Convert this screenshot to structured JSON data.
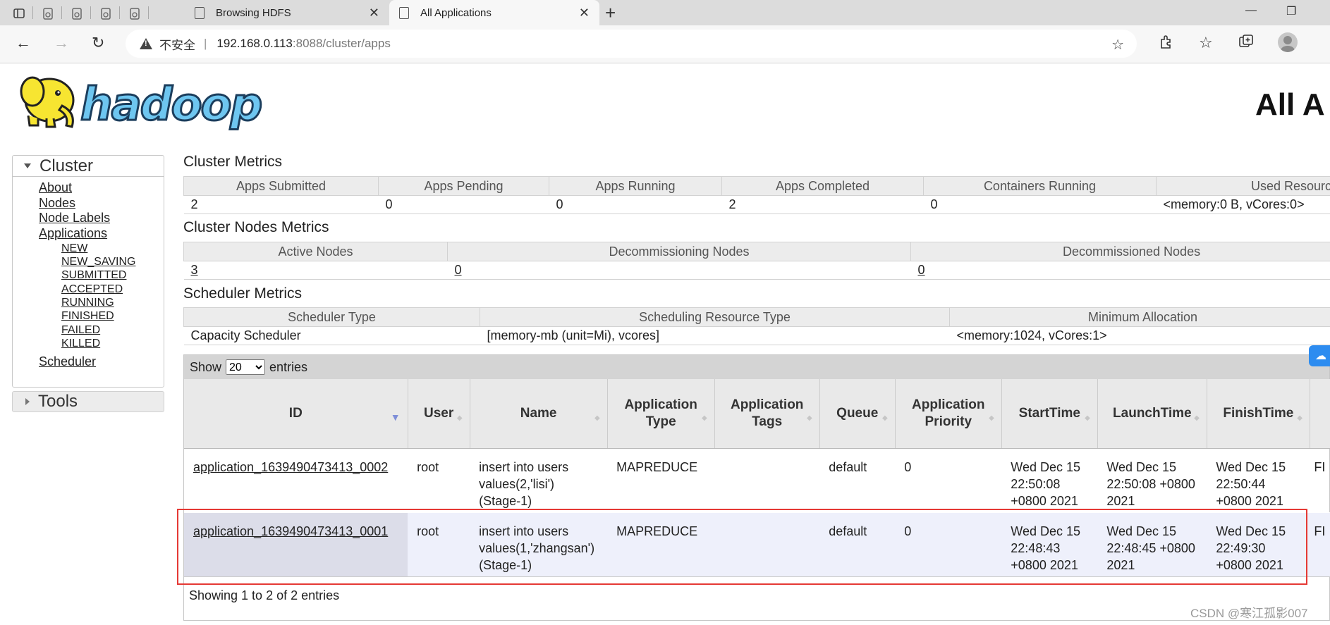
{
  "browser": {
    "tabs": [
      {
        "title": "Browsing HDFS",
        "active": false
      },
      {
        "title": "All Applications",
        "active": true
      }
    ],
    "security_label": "不安全",
    "url_host": "192.168.0.113",
    "url_rest": ":8088/cluster/apps"
  },
  "page": {
    "logo_text": "hadoop",
    "title": "All A"
  },
  "sidebar": {
    "cluster_title": "Cluster",
    "links": [
      "About",
      "Nodes",
      "Node Labels",
      "Applications"
    ],
    "app_states": [
      "NEW",
      "NEW_SAVING",
      "SUBMITTED",
      "ACCEPTED",
      "RUNNING",
      "FINISHED",
      "FAILED",
      "KILLED"
    ],
    "scheduler_link": "Scheduler",
    "tools_title": "Tools"
  },
  "cluster_metrics": {
    "title": "Cluster Metrics",
    "headers": [
      "Apps Submitted",
      "Apps Pending",
      "Apps Running",
      "Apps Completed",
      "Containers Running",
      "Used Resources"
    ],
    "values": [
      "2",
      "0",
      "0",
      "2",
      "0",
      "<memory:0 B, vCores:0>"
    ]
  },
  "node_metrics": {
    "title": "Cluster Nodes Metrics",
    "headers": [
      "Active Nodes",
      "Decommissioning Nodes",
      "Decommissioned Nodes"
    ],
    "values": [
      "3",
      "0",
      "0"
    ]
  },
  "scheduler_metrics": {
    "title": "Scheduler Metrics",
    "headers": [
      "Scheduler Type",
      "Scheduling Resource Type",
      "Minimum Allocation"
    ],
    "values": [
      "Capacity Scheduler",
      "[memory-mb (unit=Mi), vcores]",
      "<memory:1024, vCores:1>"
    ]
  },
  "apps": {
    "show_label": "Show",
    "page_size": "20",
    "entries_label": "entries",
    "columns": {
      "id": "ID",
      "user": "User",
      "name": "Name",
      "type": "Application Type",
      "tags": "Application Tags",
      "queue": "Queue",
      "priority": "Application Priority",
      "start": "StartTime",
      "launch": "LaunchTime",
      "finish": "FinishTime"
    },
    "rows": [
      {
        "id": "application_1639490473413_0002",
        "user": "root",
        "name": "insert into users values(2,'lisi') (Stage-1)",
        "type": "MAPREDUCE",
        "tags": "",
        "queue": "default",
        "priority": "0",
        "start": "Wed Dec 15 22:50:08 +0800 2021",
        "launch": "Wed Dec 15 22:50:08 +0800 2021",
        "finish": "Wed Dec 15 22:50:44 +0800 2021",
        "state": "FI"
      },
      {
        "id": "application_1639490473413_0001",
        "user": "root",
        "name": "insert into users values(1,'zhangsan') (Stage-1)",
        "type": "MAPREDUCE",
        "tags": "",
        "queue": "default",
        "priority": "0",
        "start": "Wed Dec 15 22:48:43 +0800 2021",
        "launch": "Wed Dec 15 22:48:45 +0800 2021",
        "finish": "Wed Dec 15 22:49:30 +0800 2021",
        "state": "FI"
      }
    ],
    "footer": "Showing 1 to 2 of 2 entries"
  },
  "watermark": "CSDN @寒江孤影007",
  "colors": {
    "highlight_box": "#e53935",
    "selected_row": "#eef0fb",
    "logo_blue": "#6ec6f0",
    "logo_yellow": "#f7e531"
  }
}
